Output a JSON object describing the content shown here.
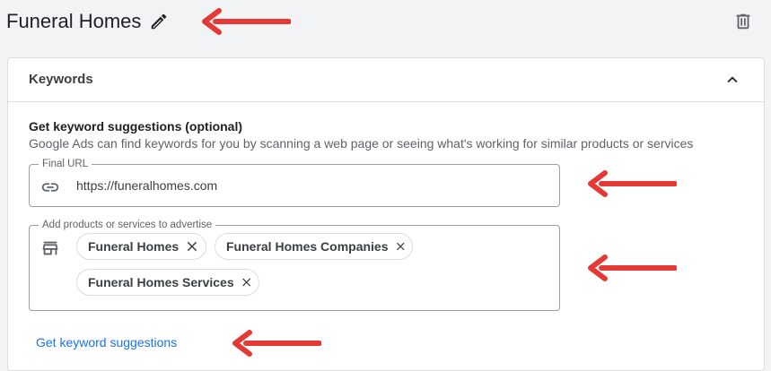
{
  "header": {
    "ad_group_name": "Funeral Homes",
    "edit_icon": "pencil-icon",
    "delete_icon": "trash-icon"
  },
  "keywords_card": {
    "title": "Keywords",
    "collapse_icon": "chevron-up-icon",
    "section_title": "Get keyword suggestions (optional)",
    "section_description": "Google Ads can find keywords for you by scanning a web page or seeing what's working for similar products or services",
    "final_url": {
      "label": "Final URL",
      "icon": "link-icon",
      "value": "https://funeralhomes.com"
    },
    "products": {
      "label": "Add products or services to advertise",
      "icon": "storefront-icon",
      "chips": [
        "Funeral Homes",
        "Funeral Homes Companies",
        "Funeral Homes Services"
      ]
    },
    "suggestions_link": "Get keyword suggestions"
  },
  "colors": {
    "page_background": "#f1f3f4",
    "card_background": "#ffffff",
    "link_blue": "#1a73e8",
    "annotation_red": "#e53935"
  }
}
